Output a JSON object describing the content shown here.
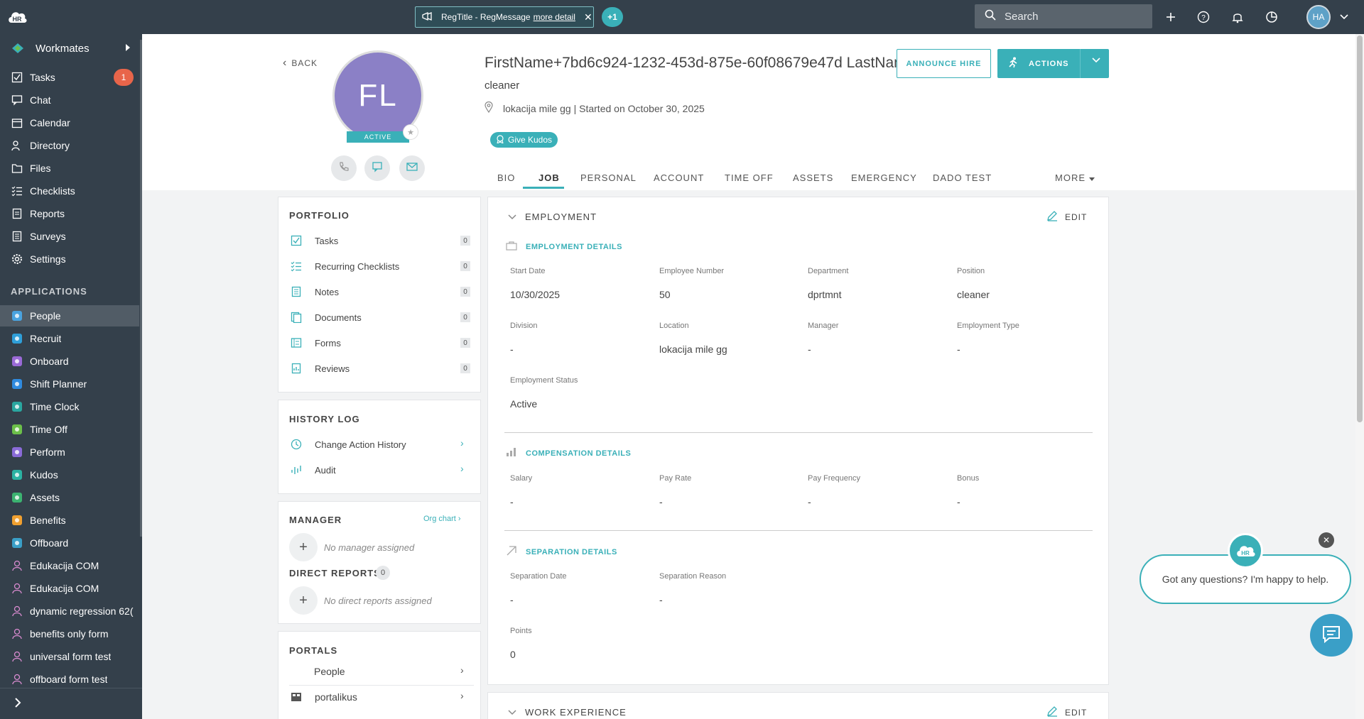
{
  "topbar": {
    "logo_text": "HR",
    "reg_title": "RegTitle - RegMessage",
    "reg_more": "more detail",
    "extra_count": "+1",
    "search_placeholder": "Search",
    "avatar_initials": "HA"
  },
  "sidebar": {
    "header": "Workmates",
    "items": [
      {
        "label": "Tasks",
        "icon": "check-square-icon",
        "badge": "1"
      },
      {
        "label": "Chat",
        "icon": "chat-icon"
      },
      {
        "label": "Calendar",
        "icon": "calendar-icon"
      },
      {
        "label": "Directory",
        "icon": "users-icon"
      },
      {
        "label": "Files",
        "icon": "folder-icon"
      },
      {
        "label": "Checklists",
        "icon": "checklist-icon"
      },
      {
        "label": "Reports",
        "icon": "report-icon"
      },
      {
        "label": "Surveys",
        "icon": "survey-icon"
      },
      {
        "label": "Settings",
        "icon": "gear-icon"
      }
    ],
    "apps_heading": "APPLICATIONS",
    "apps": [
      {
        "label": "People",
        "color": "#4aa3df"
      },
      {
        "label": "Recruit",
        "color": "#2f9fd8"
      },
      {
        "label": "Onboard",
        "color": "#9a6ad6"
      },
      {
        "label": "Shift Planner",
        "color": "#2f8be0"
      },
      {
        "label": "Time Clock",
        "color": "#2aa7a0"
      },
      {
        "label": "Time Off",
        "color": "#6cc04a"
      },
      {
        "label": "Perform",
        "color": "#8a6bd8"
      },
      {
        "label": "Kudos",
        "color": "#2bb3a3"
      },
      {
        "label": "Assets",
        "color": "#3cb371"
      },
      {
        "label": "Benefits",
        "color": "#f0a030"
      },
      {
        "label": "Offboard",
        "color": "#3a9fc7"
      },
      {
        "label": "Edukacija COM",
        "color": "#d98bd0"
      },
      {
        "label": "Edukacija COM",
        "color": "#d98bd0"
      },
      {
        "label": "dynamic regression 62(",
        "color": "#d98bd0"
      },
      {
        "label": "benefits only form",
        "color": "#d98bd0"
      },
      {
        "label": "universal form test",
        "color": "#d98bd0"
      },
      {
        "label": "offboard form test",
        "color": "#d98bd0"
      }
    ]
  },
  "profile": {
    "back_label": "BACK",
    "initials": "FL",
    "status": "ACTIVE",
    "name": "FirstName+7bd6c924-1232-453d-875e-60f08679e47d LastName",
    "position": "cleaner",
    "location_line": "lokacija mile gg | Started on October 30, 2025",
    "kudos_label": "Give Kudos",
    "announce_label": "ANNOUNCE HIRE",
    "actions_label": "ACTIONS"
  },
  "tabs": [
    "BIO",
    "JOB",
    "PERSONAL",
    "ACCOUNT",
    "TIME OFF",
    "ASSETS",
    "EMERGENCY",
    "DADO TEST",
    "MORE"
  ],
  "portfolio": {
    "heading": "PORTFOLIO",
    "items": [
      {
        "label": "Tasks",
        "count": "0"
      },
      {
        "label": "Recurring Checklists",
        "count": "0"
      },
      {
        "label": "Notes",
        "count": "0"
      },
      {
        "label": "Documents",
        "count": "0"
      },
      {
        "label": "Forms",
        "count": "0"
      },
      {
        "label": "Reviews",
        "count": "0"
      }
    ]
  },
  "history": {
    "heading": "HISTORY LOG",
    "items": [
      "Change Action History",
      "Audit"
    ]
  },
  "manager": {
    "heading": "MANAGER",
    "org_chart": "Org chart",
    "no_manager": "No manager assigned",
    "direct_heading": "DIRECT REPORTS",
    "direct_count": "0",
    "no_direct": "No direct reports assigned"
  },
  "portals": {
    "heading": "PORTALS",
    "items": [
      "People",
      "portalikus"
    ]
  },
  "employment": {
    "heading": "EMPLOYMENT",
    "edit_label": "EDIT",
    "details_heading": "EMPLOYMENT DETAILS",
    "fields": [
      {
        "label": "Start Date",
        "value": "10/30/2025"
      },
      {
        "label": "Employee Number",
        "value": "50"
      },
      {
        "label": "Department",
        "value": "dprtmnt"
      },
      {
        "label": "Position",
        "value": "cleaner"
      },
      {
        "label": "Division",
        "value": "-"
      },
      {
        "label": "Location",
        "value": "lokacija mile gg"
      },
      {
        "label": "Manager",
        "value": "-"
      },
      {
        "label": "Employment Type",
        "value": "-"
      },
      {
        "label": "Employment Status",
        "value": "Active"
      }
    ],
    "comp_heading": "COMPENSATION DETAILS",
    "comp_fields": [
      {
        "label": "Salary",
        "value": "-"
      },
      {
        "label": "Pay Rate",
        "value": "-"
      },
      {
        "label": "Pay Frequency",
        "value": "-"
      },
      {
        "label": "Bonus",
        "value": "-"
      }
    ],
    "sep_heading": "SEPARATION DETAILS",
    "sep_fields": [
      {
        "label": "Separation Date",
        "value": "-"
      },
      {
        "label": "Separation Reason",
        "value": "-"
      },
      {
        "label": "Points",
        "value": "0"
      }
    ]
  },
  "work_experience": {
    "heading": "WORK EXPERIENCE",
    "edit_label": "EDIT"
  },
  "chat": {
    "logo_text": "HR",
    "message": "Got any questions? I'm happy to help."
  },
  "colors": {
    "accent": "#3ab0b8",
    "sidebar_bg": "#34404b",
    "badge_red": "#e8654a"
  }
}
